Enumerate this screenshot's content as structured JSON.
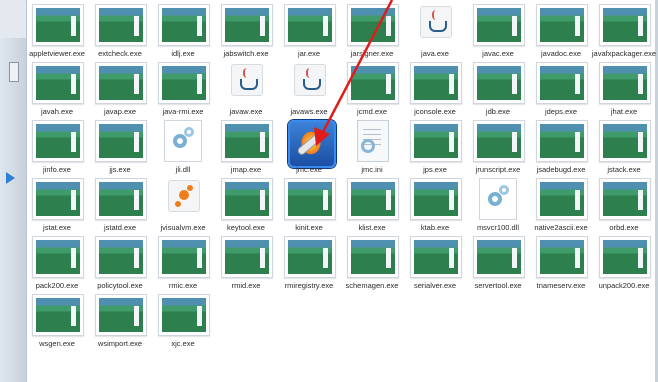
{
  "explorer": {
    "files": [
      {
        "name": "appletviewer.exe",
        "icon": "exe"
      },
      {
        "name": "extcheck.exe",
        "icon": "exe"
      },
      {
        "name": "idlj.exe",
        "icon": "exe"
      },
      {
        "name": "jabswitch.exe",
        "icon": "exe"
      },
      {
        "name": "jar.exe",
        "icon": "exe"
      },
      {
        "name": "jarsigner.exe",
        "icon": "exe"
      },
      {
        "name": "java.exe",
        "icon": "java"
      },
      {
        "name": "javac.exe",
        "icon": "exe"
      },
      {
        "name": "javadoc.exe",
        "icon": "exe"
      },
      {
        "name": "javafxpackager.exe",
        "icon": "exe"
      },
      {
        "name": "javah.exe",
        "icon": "exe"
      },
      {
        "name": "javap.exe",
        "icon": "exe"
      },
      {
        "name": "java-rmi.exe",
        "icon": "exe"
      },
      {
        "name": "javaw.exe",
        "icon": "java"
      },
      {
        "name": "javaws.exe",
        "icon": "java"
      },
      {
        "name": "jcmd.exe",
        "icon": "exe"
      },
      {
        "name": "jconsole.exe",
        "icon": "exe"
      },
      {
        "name": "jdb.exe",
        "icon": "exe"
      },
      {
        "name": "jdeps.exe",
        "icon": "exe"
      },
      {
        "name": "jhat.exe",
        "icon": "exe"
      },
      {
        "name": "jinfo.exe",
        "icon": "exe"
      },
      {
        "name": "jjs.exe",
        "icon": "exe"
      },
      {
        "name": "jli.dll",
        "icon": "dll"
      },
      {
        "name": "jmap.exe",
        "icon": "exe"
      },
      {
        "name": "jmc.exe",
        "icon": "jmc"
      },
      {
        "name": "jmc.ini",
        "icon": "ini"
      },
      {
        "name": "jps.exe",
        "icon": "exe"
      },
      {
        "name": "jrunscript.exe",
        "icon": "exe"
      },
      {
        "name": "jsadebugd.exe",
        "icon": "exe"
      },
      {
        "name": "jstack.exe",
        "icon": "exe"
      },
      {
        "name": "jstat.exe",
        "icon": "exe"
      },
      {
        "name": "jstatd.exe",
        "icon": "exe"
      },
      {
        "name": "jvisualvm.exe",
        "icon": "jvisualvm"
      },
      {
        "name": "keytool.exe",
        "icon": "exe"
      },
      {
        "name": "kinit.exe",
        "icon": "exe"
      },
      {
        "name": "klist.exe",
        "icon": "exe"
      },
      {
        "name": "ktab.exe",
        "icon": "exe"
      },
      {
        "name": "msvcr100.dll",
        "icon": "dll"
      },
      {
        "name": "native2ascii.exe",
        "icon": "exe"
      },
      {
        "name": "orbd.exe",
        "icon": "exe"
      },
      {
        "name": "pack200.exe",
        "icon": "exe"
      },
      {
        "name": "policytool.exe",
        "icon": "exe"
      },
      {
        "name": "rmic.exe",
        "icon": "exe"
      },
      {
        "name": "rmid.exe",
        "icon": "exe"
      },
      {
        "name": "rmiregistry.exe",
        "icon": "exe"
      },
      {
        "name": "schemagen.exe",
        "icon": "exe"
      },
      {
        "name": "serialver.exe",
        "icon": "exe"
      },
      {
        "name": "servertool.exe",
        "icon": "exe"
      },
      {
        "name": "tnameserv.exe",
        "icon": "exe"
      },
      {
        "name": "unpack200.exe",
        "icon": "exe"
      },
      {
        "name": "wsgen.exe",
        "icon": "exe"
      },
      {
        "name": "wsimport.exe",
        "icon": "exe"
      },
      {
        "name": "xjc.exe",
        "icon": "exe"
      }
    ],
    "colors": {
      "annotation_arrow": "#e01b1b",
      "left_marker": "#2f7fd6"
    }
  }
}
